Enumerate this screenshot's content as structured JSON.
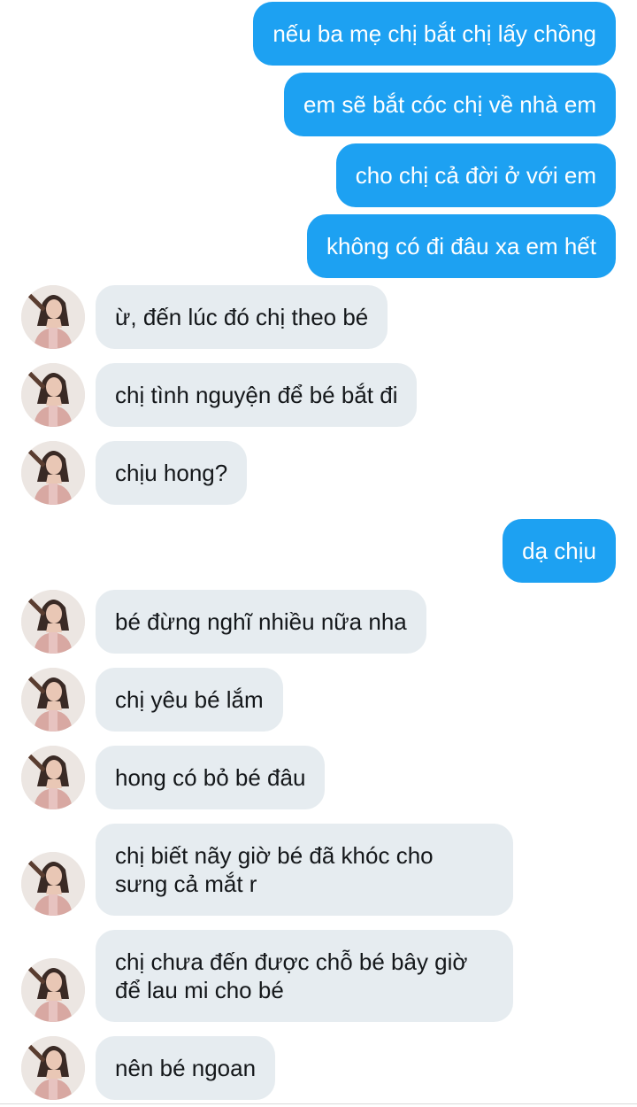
{
  "colors": {
    "outgoing_bubble": "#1da1f2",
    "incoming_bubble": "#e6ecf0",
    "outgoing_text": "#ffffff",
    "incoming_text": "#14171a"
  },
  "messages": [
    {
      "direction": "out",
      "text": "nếu ba mẹ chị bắt chị lấy chồng"
    },
    {
      "direction": "out",
      "text": "em sẽ bắt cóc chị về nhà em"
    },
    {
      "direction": "out",
      "text": "cho chị cả đời ở với em"
    },
    {
      "direction": "out",
      "text": "không có đi đâu xa em hết"
    },
    {
      "direction": "in",
      "text": "ừ, đến lúc đó chị theo bé",
      "avatar": "contact-avatar"
    },
    {
      "direction": "in",
      "text": "chị tình nguyện để bé bắt đi",
      "avatar": "contact-avatar"
    },
    {
      "direction": "in",
      "text": "chịu hong?",
      "avatar": "contact-avatar"
    },
    {
      "direction": "out",
      "text": "dạ chịu"
    },
    {
      "direction": "in",
      "text": "bé đừng nghĩ nhiều nữa nha",
      "avatar": "contact-avatar"
    },
    {
      "direction": "in",
      "text": "chị yêu bé lắm",
      "avatar": "contact-avatar"
    },
    {
      "direction": "in",
      "text": "hong có bỏ bé đâu",
      "avatar": "contact-avatar"
    },
    {
      "direction": "in",
      "text": "chị biết nãy giờ bé đã khóc cho\nsưng cả mắt r",
      "avatar": "contact-avatar"
    },
    {
      "direction": "in",
      "text": "chị chưa đến được chỗ bé bây giờ\nđể lau mi cho bé",
      "avatar": "contact-avatar"
    },
    {
      "direction": "in",
      "text": "nên bé ngoan",
      "avatar": "contact-avatar"
    }
  ]
}
